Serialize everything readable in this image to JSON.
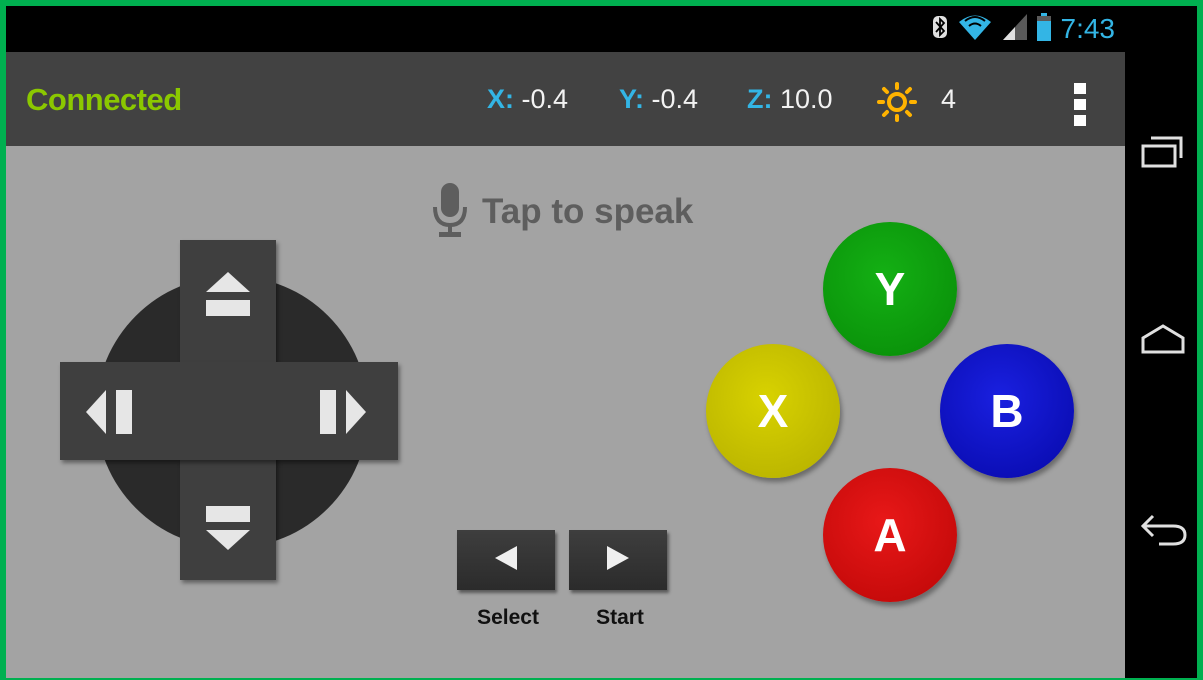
{
  "status_bar": {
    "time": "7:43",
    "icons": [
      "bluetooth-icon",
      "wifi-icon",
      "cell-signal-icon",
      "battery-icon"
    ],
    "accent": "#33b5e5"
  },
  "action_bar": {
    "connection_status": "Connected",
    "readouts": {
      "x_label": "X:",
      "x_value": "-0.4",
      "y_label": "Y:",
      "y_value": "-0.4",
      "z_label": "Z:",
      "z_value": "10.0",
      "light_value": "4"
    },
    "icons": [
      "sun-icon",
      "overflow-menu-icon"
    ],
    "connected_color": "#8bc800"
  },
  "voice": {
    "label": "Tap to speak",
    "icon": "microphone-icon"
  },
  "dpad": {
    "icons": [
      "dpad-up-icon",
      "dpad-down-icon",
      "dpad-left-icon",
      "dpad-right-icon"
    ]
  },
  "controls": {
    "select_label": "Select",
    "start_label": "Start"
  },
  "face_buttons": {
    "y": {
      "label": "Y",
      "color": "#0a9a0a"
    },
    "x": {
      "label": "X",
      "color": "#c8c200"
    },
    "b": {
      "label": "B",
      "color": "#0a10c8"
    },
    "a": {
      "label": "A",
      "color": "#d80a0a"
    }
  },
  "nav_bar": {
    "icons": [
      "recent-apps-icon",
      "home-icon",
      "back-icon"
    ]
  }
}
